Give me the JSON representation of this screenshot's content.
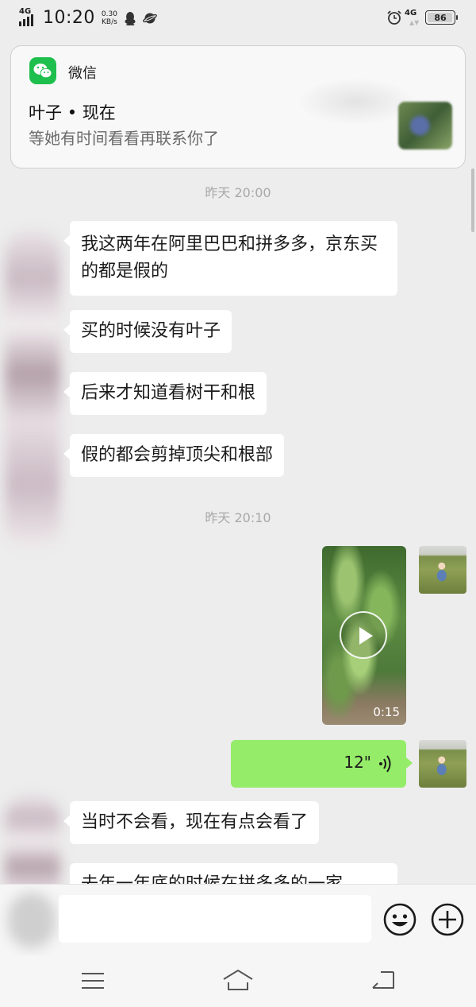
{
  "status_bar": {
    "network_left": "4G",
    "time": "10:20",
    "speed_value": "0.30",
    "speed_unit": "KB/s",
    "icons": [
      "signal-icon",
      "qq-icon",
      "planet-icon",
      "alarm-icon",
      "network-4g-icon",
      "battery-icon"
    ],
    "network_right": "4G",
    "battery": "86",
    "battery_level": 0.86
  },
  "notification": {
    "app_name": "微信",
    "sender": "叶子",
    "time": "现在",
    "message": "等她有时间看看再联系你了",
    "accent_color": "#1fbf4d"
  },
  "chat": {
    "timestamp_1": "昨天 20:00",
    "incoming_1": [
      "我这两年在阿里巴巴和拼多多，京东买的都是假的",
      "买的时候没有叶子",
      "后来才知道看树干和根",
      "假的都会剪掉顶尖和根部"
    ],
    "timestamp_2": "昨天 20:10",
    "video": {
      "duration": "0:15"
    },
    "voice": {
      "duration": "12\""
    },
    "incoming_2": [
      "当时不会看，现在有点会看了",
      "去年一年底的时候在拼多多的一家"
    ],
    "sent_bubble_color": "#95ec69"
  },
  "input_bar": {
    "text_value": "",
    "icons": [
      "emoji-icon",
      "plus-icon"
    ]
  },
  "nav_bar": {
    "icons": [
      "menu-icon",
      "home-icon",
      "back-icon"
    ]
  }
}
